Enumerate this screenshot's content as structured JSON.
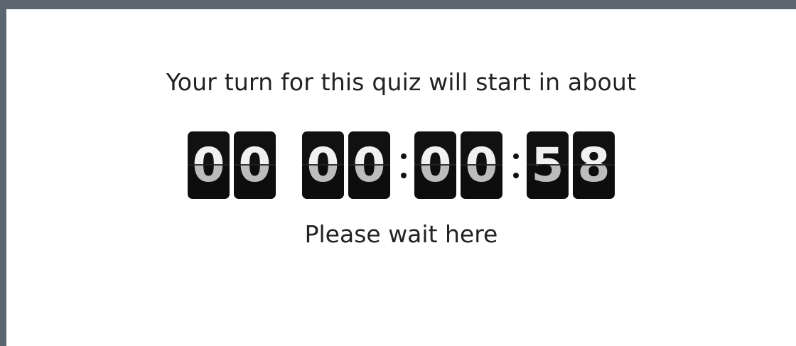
{
  "message": "Your turn for this quiz will start in about",
  "countdown": {
    "days": [
      "0",
      "0"
    ],
    "hours": [
      "0",
      "0"
    ],
    "minutes": [
      "0",
      "0"
    ],
    "seconds": [
      "5",
      "8"
    ]
  },
  "wait_text": "Please wait here",
  "colors": {
    "frame": "#5c6670",
    "digit_bg": "#111111",
    "digit_text": "#f1f1f1",
    "text": "#222222"
  }
}
